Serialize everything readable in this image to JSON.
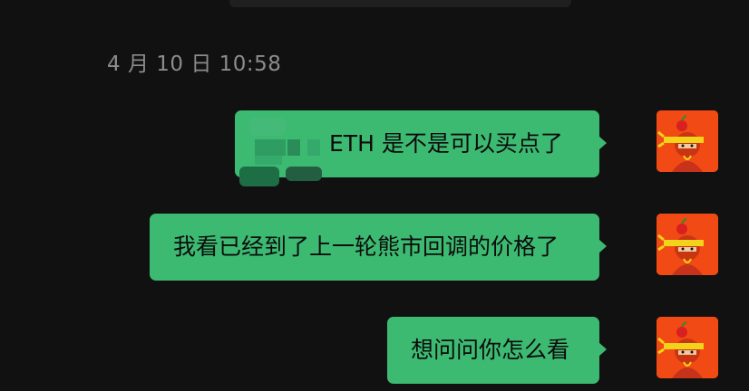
{
  "chat": {
    "timestamp": "4 月 10 日 10:58",
    "messages": [
      {
        "text": "ETH 是不是可以买点了",
        "sender": "self",
        "has_redacted_prefix": true
      },
      {
        "text": "我看已经到了上一轮熊市回调的价格了",
        "sender": "self"
      },
      {
        "text": "想问问你怎么看",
        "sender": "self"
      }
    ]
  },
  "colors": {
    "background": "#111111",
    "bubble": "#3dba72",
    "avatar_bg": "#f24a14",
    "timestamp": "#8c8c8c"
  },
  "icons": {
    "avatar": "cartoon-character-avatar"
  }
}
